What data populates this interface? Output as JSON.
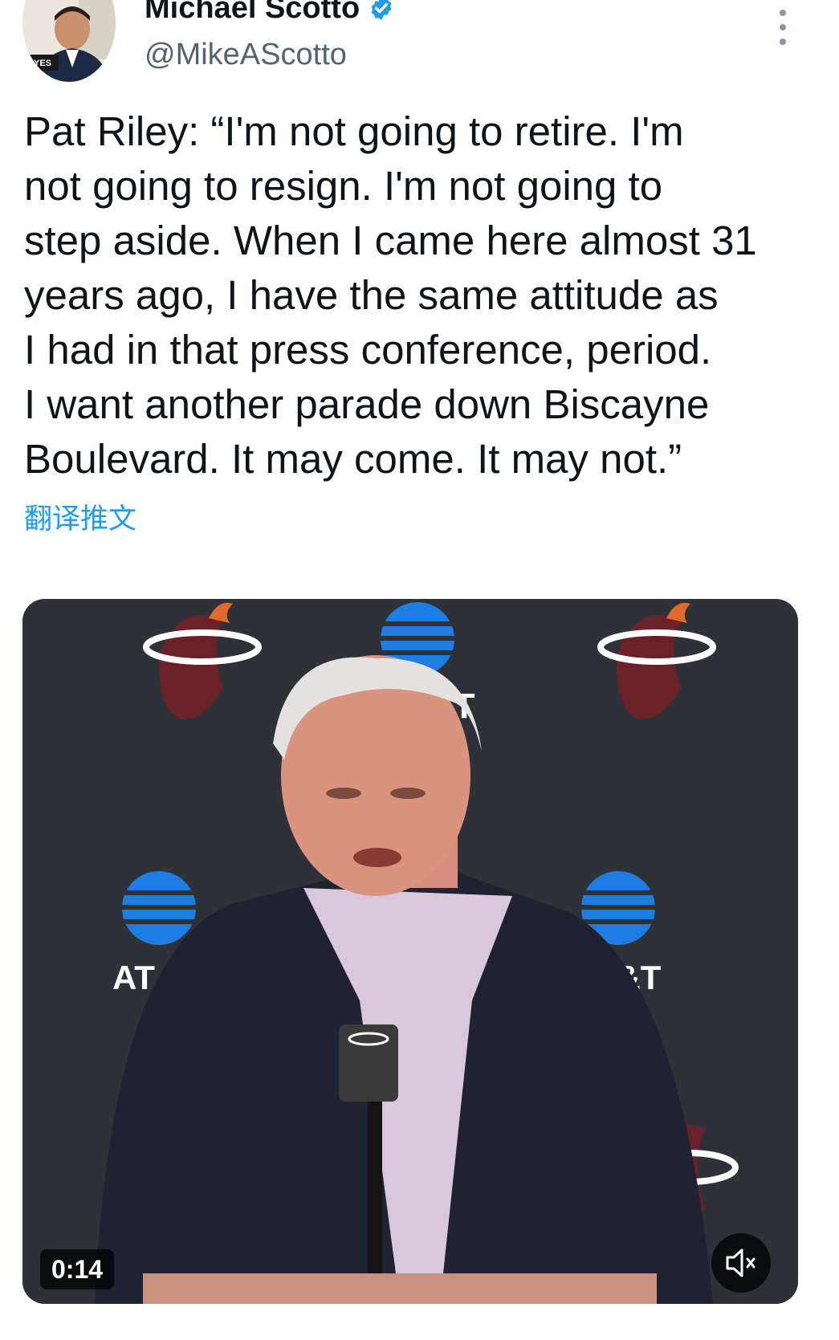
{
  "author": {
    "display_name": "Michael Scotto",
    "handle": "@MikeAScotto",
    "verified": true,
    "verified_color": "#1d9bf0",
    "avatar_icon": "profile-photo",
    "avatar_badge_text": "YES"
  },
  "menu": {
    "icon": "more-vertical-icon"
  },
  "tweet": {
    "text": "Pat Riley: “I'm not going to retire. I'm\nnot going to resign. I'm not going to\nstep aside. When I came here almost 31\nyears ago, I have the same attitude as\nI had in that press conference, period.\nI want another parade down Biscayne\nBoulevard. It may come. It may not.”",
    "translate_label": "翻译推文"
  },
  "video": {
    "duration": "0:14",
    "mute_icon": "volume-muted-icon",
    "backdrop_texts": [
      "T&T",
      "AT",
      "\\T&T"
    ],
    "accent_color": "#1d9bf0"
  }
}
